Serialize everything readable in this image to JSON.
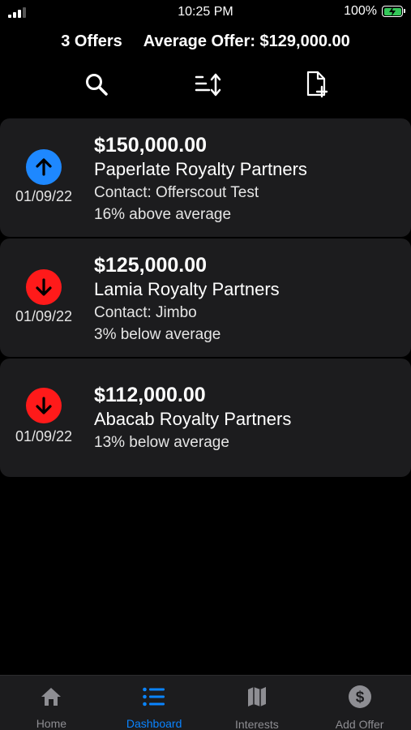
{
  "status_bar": {
    "time": "10:25 PM",
    "battery": "100%"
  },
  "summary": {
    "count": "3 Offers",
    "average": "Average Offer: $129,000.00"
  },
  "toolbar": {
    "icons": [
      "search-icon",
      "sort-icon",
      "add-document-icon"
    ]
  },
  "offers": [
    {
      "direction": "up",
      "color": "#1e88ff",
      "date": "01/09/22",
      "amount": "$150,000.00",
      "company": "Paperlate Royalty Partners",
      "contact": "Contact: Offerscout Test",
      "diff": "16% above average"
    },
    {
      "direction": "down",
      "color": "#ff1a1a",
      "date": "01/09/22",
      "amount": "$125,000.00",
      "company": "Lamia Royalty Partners",
      "contact": "Contact: Jimbo",
      "diff": "3% below average"
    },
    {
      "direction": "down",
      "color": "#ff1a1a",
      "date": "01/09/22",
      "amount": "$112,000.00",
      "company": "Abacab Royalty Partners",
      "diff": "13% below average"
    }
  ],
  "tabs": [
    {
      "label": "Home",
      "icon": "home-icon"
    },
    {
      "label": "Dashboard",
      "icon": "list-icon",
      "active": true
    },
    {
      "label": "Interests",
      "icon": "map-icon"
    },
    {
      "label": "Add Offer",
      "icon": "dollar-icon"
    }
  ],
  "colors": {
    "accent": "#0a84ff",
    "up": "#1e88ff",
    "down": "#ff1a1a",
    "card": "#1c1c1e"
  }
}
